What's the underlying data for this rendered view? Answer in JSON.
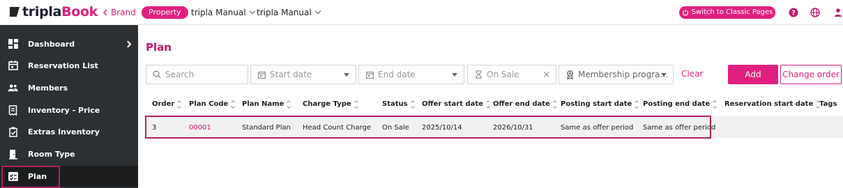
{
  "app": {
    "logo_prefix": "tripla",
    "logo_suffix": "Book"
  },
  "header": {
    "brand_link": "Brand",
    "property_chip": "Property",
    "dropdown_1": "tripla Manual",
    "dropdown_2": "tripla Manual",
    "classic_button": "Switch to Classic Pages"
  },
  "sidebar": {
    "items": [
      {
        "label": "Dashboard",
        "icon": "dashboard-icon",
        "has_chevron": true
      },
      {
        "label": "Reservation List",
        "icon": "calendar-icon"
      },
      {
        "label": "Members",
        "icon": "members-icon"
      },
      {
        "label": "Inventory - Price",
        "icon": "receipt-icon"
      },
      {
        "label": "Extras Inventory",
        "icon": "clipboard-check-icon"
      },
      {
        "label": "Room Type",
        "icon": "door-icon"
      },
      {
        "label": "Plan",
        "icon": "plan-icon",
        "active": true
      }
    ]
  },
  "main": {
    "title": "Plan",
    "filters": {
      "search_placeholder": "Search",
      "start_date_placeholder": "Start date",
      "end_date_placeholder": "End date",
      "status_value": "On Sale",
      "membership_placeholder": "Membership progra..."
    },
    "clear_label": "Clear",
    "add_label": "Add",
    "change_order_label": "Change order"
  },
  "table": {
    "columns": [
      "Order",
      "Plan Code",
      "Plan Name",
      "Charge Type",
      "Status",
      "Offer start date",
      "Offer end date",
      "Posting start date",
      "Posting end date",
      "Reservation start date",
      "Tags"
    ],
    "rows": [
      [
        "3",
        "00001",
        "Standard Plan",
        "Head Count Charge",
        "On Sale",
        "2025/10/14",
        "2026/10/31",
        "Same as offer period",
        "Same as offer period",
        "",
        ""
      ]
    ]
  },
  "colors": {
    "accent": "#e0207e",
    "sidebar_bg": "#2c3032",
    "highlight_border": "#b3205f"
  }
}
